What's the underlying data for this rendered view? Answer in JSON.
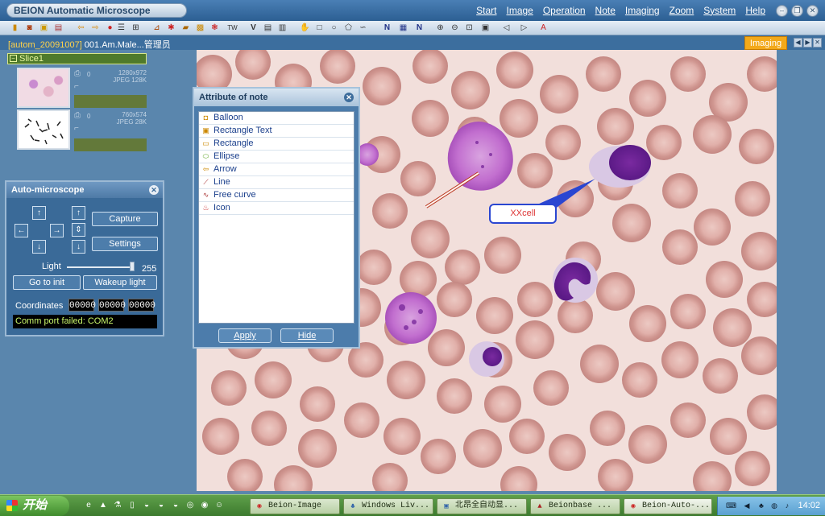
{
  "app": {
    "title": "BEION Automatic Microscope",
    "menu": [
      "Start",
      "Image",
      "Operation",
      "Note",
      "Imaging",
      "Zoom",
      "System",
      "Help"
    ],
    "window_buttons": [
      "minimize-icon",
      "restore-icon",
      "close-icon"
    ]
  },
  "document": {
    "title_highlight": "[autom_20091007]",
    "title_rest": " 001.Am.Male...管理员",
    "active_tab": "Imaging"
  },
  "slice": {
    "label": "Slice1",
    "thumbnails": [
      {
        "count": "0",
        "dims": "1280x972",
        "format": "JPEG 128K"
      },
      {
        "count": "0",
        "dims": "760x574",
        "format": "JPEG 28K"
      }
    ]
  },
  "auto_microscope": {
    "title": "Auto-microscope",
    "capture": "Capture",
    "settings": "Settings",
    "light_label": "Light",
    "light_value": "255",
    "light_level": 1.0,
    "go_to_init": "Go to init",
    "wakeup_light": "Wakeup light",
    "coordinates_label": "Coordinates",
    "coordinates": [
      "00000",
      "00000",
      "00000"
    ],
    "status": "Comm port failed: COM2"
  },
  "note_dialog": {
    "title": "Attribute of note",
    "items": [
      {
        "label": "Balloon",
        "icon": "balloon-icon"
      },
      {
        "label": "Rectangle Text",
        "icon": "rectangle-text-icon"
      },
      {
        "label": "Rectangle",
        "icon": "rectangle-icon"
      },
      {
        "label": "Ellipse",
        "icon": "ellipse-icon"
      },
      {
        "label": "Arrow",
        "icon": "arrow-icon"
      },
      {
        "label": "Line",
        "icon": "line-icon"
      },
      {
        "label": "Free curve",
        "icon": "free-curve-icon"
      },
      {
        "label": "Icon",
        "icon": "icon-icon"
      }
    ],
    "apply": "Apply",
    "hide": "Hide"
  },
  "annotation": {
    "label": "XXcell"
  },
  "taskbar": {
    "start": "开始",
    "tasks": [
      "Beion-Image",
      "Windows Liv...",
      "北昂全自动显...",
      "Beionbase ...",
      "Beion-Auto-..."
    ],
    "clock": "14:02"
  }
}
